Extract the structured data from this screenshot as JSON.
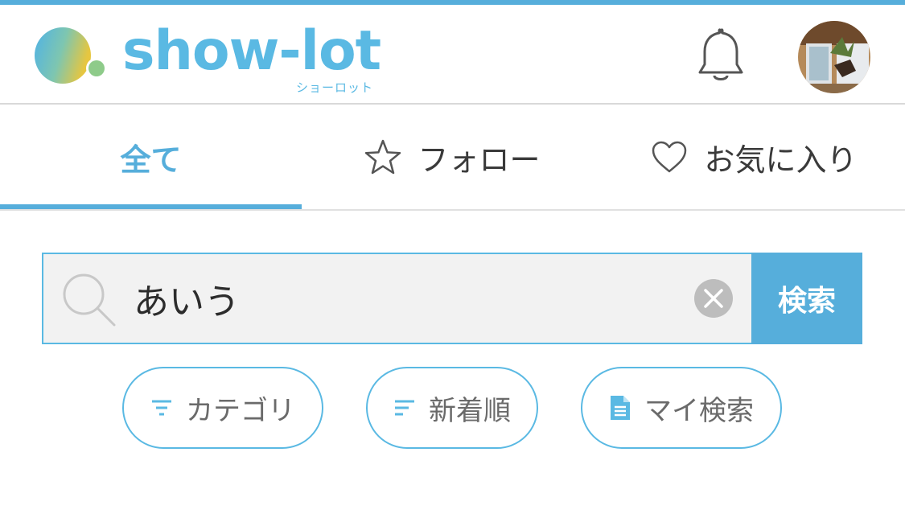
{
  "app": {
    "name": "show-lot",
    "name_kana": "ショーロット",
    "accent_color": "#56aedb"
  },
  "header": {
    "icons": [
      "notification-bell-icon",
      "user-avatar"
    ]
  },
  "tabs": [
    {
      "label": "全て",
      "icon": "",
      "active": true
    },
    {
      "label": "フォロー",
      "icon": "star-outline-icon",
      "active": false
    },
    {
      "label": "お気に入り",
      "icon": "heart-outline-icon",
      "active": false
    }
  ],
  "search": {
    "value": "あいう",
    "button_label": "検索",
    "icons": [
      "search-icon",
      "clear-icon"
    ]
  },
  "filters": [
    {
      "label": "カテゴリ",
      "icon": "filter-icon"
    },
    {
      "label": "新着順",
      "icon": "sort-icon"
    },
    {
      "label": "マイ検索",
      "icon": "document-icon"
    }
  ]
}
